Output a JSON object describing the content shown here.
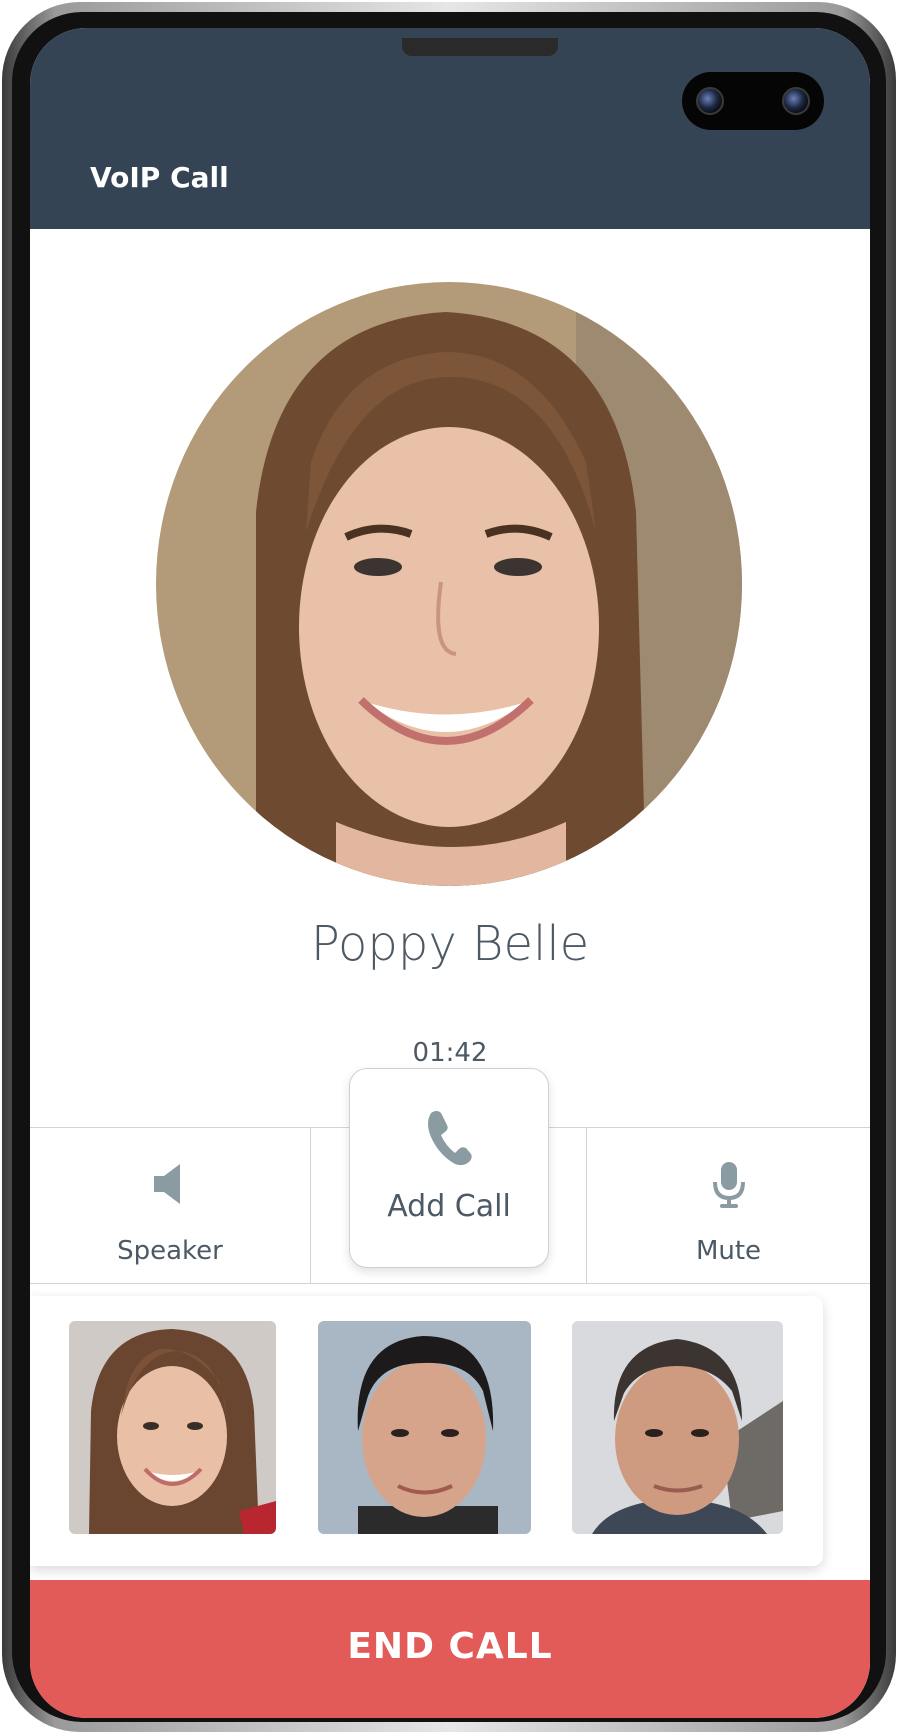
{
  "header": {
    "title": "VoIP Call"
  },
  "caller": {
    "name": "Poppy Belle",
    "duration": "01:42"
  },
  "controls": {
    "speaker_label": "Speaker",
    "add_call_label": "Add Call",
    "mute_label": "Mute"
  },
  "icons": {
    "speaker": "speaker-icon",
    "add_call": "phone-icon",
    "mute": "microphone-icon"
  },
  "contacts": [
    {
      "photo": "woman-brown-hair"
    },
    {
      "photo": "man-dark-hair"
    },
    {
      "photo": "man-short-hair"
    }
  ],
  "end_call": {
    "label": "END CALL"
  },
  "colors": {
    "header_bg": "#354455",
    "end_call_bg": "#e35b59",
    "text": "#4d5964",
    "icon": "#8a9ba1"
  }
}
